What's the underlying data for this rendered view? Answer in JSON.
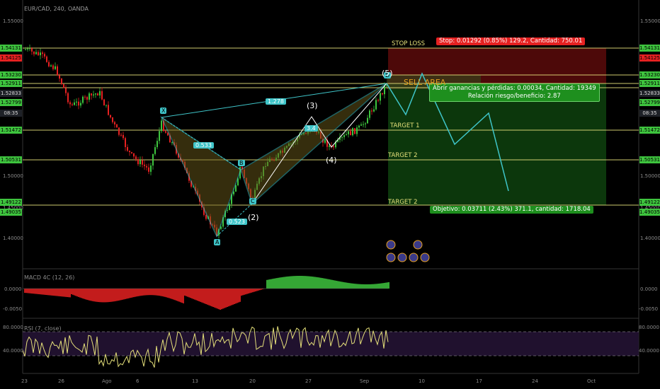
{
  "chart": {
    "symbol": "EUR/CAD, 240, OANDA",
    "price_scale": {
      "left_ticks": [
        "1.55000",
        "1.50000",
        "1.45000",
        "1.40000"
      ],
      "right_ticks": [
        "1.55000",
        "1.50000",
        "1.45000",
        "1.40000"
      ]
    },
    "left_badges": [
      {
        "text": "1.54131",
        "color": "#3ec43e"
      },
      {
        "text": "1.54125",
        "color": "#e52121"
      },
      {
        "text": "1.53230",
        "color": "#3ec43e"
      },
      {
        "text": "1.52911",
        "color": "#3ec43e"
      },
      {
        "text": "1.52833",
        "color": "#1e2127"
      },
      {
        "text": "1.52799",
        "color": "#3ec43e"
      },
      {
        "text": "08:35",
        "color": "#1e2127"
      },
      {
        "text": "1.51472",
        "color": "#3ec43e"
      },
      {
        "text": "1.50531",
        "color": "#3ec43e"
      },
      {
        "text": "1.49122",
        "color": "#3ec43e"
      },
      {
        "text": "1.49035",
        "color": "#3ec43e"
      }
    ],
    "right_badges": [
      {
        "text": "1.54131",
        "color": "#3ec43e"
      },
      {
        "text": "1.54125",
        "color": "#e52121"
      },
      {
        "text": "1.53230",
        "color": "#3ec43e"
      },
      {
        "text": "1.52911",
        "color": "#3ec43e"
      },
      {
        "text": "1.52833",
        "color": "#1e2127"
      },
      {
        "text": "1.52799",
        "color": "#3ec43e"
      },
      {
        "text": "08:35",
        "color": "#1e2127"
      },
      {
        "text": "1.51472",
        "color": "#3ec43e"
      },
      {
        "text": "1.50531",
        "color": "#3ec43e"
      },
      {
        "text": "1.49122",
        "color": "#3ec43e"
      },
      {
        "text": "1.49035",
        "color": "#3ec43e"
      }
    ],
    "levels": {
      "stop_loss": "STOP LOSS",
      "sell_area": "SELL AREA",
      "target1": "TARGET 1",
      "target2a": "TARGET 2",
      "target2b": "TARGET 2"
    },
    "stop_box": "Stop: 0.01292 (0.85%) 129.2, Cantidad: 750.01",
    "pnl_box": {
      "line1": "Abrir ganancias y pérdidas: 0.00034, Cantidad: 19349",
      "line2": "Relación riesgo/beneficio: 2.87"
    },
    "target_box": "Objetivo: 0.03711 (2.43%) 371.1, cantidad: 1718.04",
    "pattern_labels": {
      "x": "X",
      "a": "A",
      "b": "B",
      "c": "C",
      "d": "D",
      "r_xb": "0.533",
      "r_xd": "1.278",
      "r_ac": "0.523",
      "r_bd": "3.4"
    },
    "wave_labels": [
      "(2)",
      "(3)",
      "(4)",
      "(5)"
    ],
    "colors": {
      "up": "#3ec43e",
      "down": "#e52121",
      "pattern": "#3fc5c9",
      "level": "#e5e07a",
      "profit": "#0d3d0d",
      "loss": "#5a0a0a"
    }
  },
  "macd": {
    "title": "MACD 4C (12, 26)",
    "ticks": [
      "0.0000",
      "-0.0050"
    ],
    "right_ticks": [
      "0.0000",
      "-0.0050"
    ]
  },
  "rsi": {
    "title": "RSI (7, close)",
    "ticks": [
      "80.0000",
      "40.0000"
    ],
    "right_ticks": [
      "80.0000",
      "40.0000"
    ]
  },
  "time_axis": [
    "23",
    "26",
    "Ago",
    "6",
    "13",
    "20",
    "27",
    "Sep",
    "10",
    "17",
    "24",
    "Oct"
  ]
}
